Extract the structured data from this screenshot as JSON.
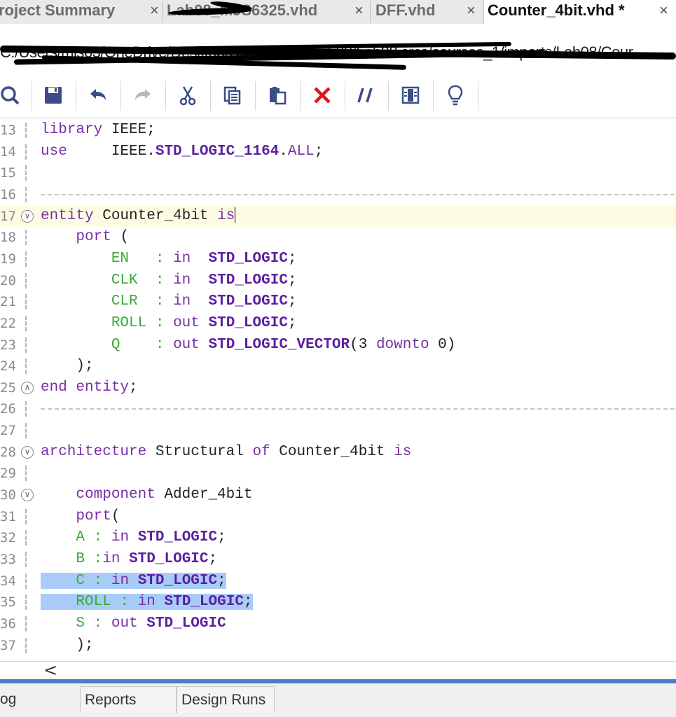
{
  "tabs": [
    {
      "label": "roject Summary",
      "close": "×"
    },
    {
      "label": "Lab08_MJS6325.vhd",
      "close": "×"
    },
    {
      "label": "DFF.vhd",
      "close": "×"
    },
    {
      "label": "Counter_4bit.vhd *",
      "close": "×"
    }
  ],
  "path": "C:/Users/mjs63/OneDrive/Desktop/CMPEN270/Lab08/Lab08.srcs/sources_1/imports/Lab08/Cour",
  "toolbar": [
    {
      "name": "search-icon"
    },
    {
      "name": "save-icon"
    },
    {
      "name": "undo-icon"
    },
    {
      "name": "redo-icon"
    },
    {
      "name": "cut-icon"
    },
    {
      "name": "copy-icon"
    },
    {
      "name": "paste-icon"
    },
    {
      "name": "delete-icon"
    },
    {
      "name": "comment-icon"
    },
    {
      "name": "column-select-icon"
    },
    {
      "name": "lightbulb-icon"
    }
  ],
  "colors": {
    "keyword": "#7a2ea8",
    "type": "#5c1ea0",
    "signal": "#3aaa35",
    "selection": "#a8ccf7",
    "current_line": "#fdfce3"
  },
  "lines": [
    {
      "num": "13",
      "tokens": [
        [
          "kw",
          "library"
        ],
        [
          "plain",
          " IEEE;"
        ]
      ]
    },
    {
      "num": "14",
      "tokens": [
        [
          "kw",
          "use"
        ],
        [
          "plain",
          "     IEEE."
        ],
        [
          "typ",
          "STD_LOGIC_1164"
        ],
        [
          "plain",
          "."
        ],
        [
          "kw",
          "ALL"
        ],
        [
          "plain",
          ";"
        ]
      ]
    },
    {
      "num": "15",
      "tokens": []
    },
    {
      "num": "16",
      "dashed": true,
      "tokens": []
    },
    {
      "num": "17",
      "fold": "open",
      "current": true,
      "caret": true,
      "tokens": [
        [
          "kw",
          "entity"
        ],
        [
          "plain",
          " Counter_4bit "
        ],
        [
          "kw",
          "is"
        ]
      ]
    },
    {
      "num": "18",
      "tokens": [
        [
          "plain",
          "    "
        ],
        [
          "kw",
          "port"
        ],
        [
          "plain",
          " ("
        ]
      ]
    },
    {
      "num": "19",
      "tokens": [
        [
          "plain",
          "        "
        ],
        [
          "sig",
          "EN"
        ],
        [
          "plain",
          "   "
        ],
        [
          "sig",
          ":"
        ],
        [
          "plain",
          " "
        ],
        [
          "kw",
          "in"
        ],
        [
          "plain",
          "  "
        ],
        [
          "typ",
          "STD_LOGIC"
        ],
        [
          "plain",
          ";"
        ]
      ]
    },
    {
      "num": "20",
      "tokens": [
        [
          "plain",
          "        "
        ],
        [
          "sig",
          "CLK"
        ],
        [
          "plain",
          "  "
        ],
        [
          "sig",
          ":"
        ],
        [
          "plain",
          " "
        ],
        [
          "kw",
          "in"
        ],
        [
          "plain",
          "  "
        ],
        [
          "typ",
          "STD_LOGIC"
        ],
        [
          "plain",
          ";"
        ]
      ]
    },
    {
      "num": "21",
      "tokens": [
        [
          "plain",
          "        "
        ],
        [
          "sig",
          "CLR"
        ],
        [
          "plain",
          "  "
        ],
        [
          "sig",
          ":"
        ],
        [
          "plain",
          " "
        ],
        [
          "kw",
          "in"
        ],
        [
          "plain",
          "  "
        ],
        [
          "typ",
          "STD_LOGIC"
        ],
        [
          "plain",
          ";"
        ]
      ]
    },
    {
      "num": "22",
      "tokens": [
        [
          "plain",
          "        "
        ],
        [
          "sig",
          "ROLL"
        ],
        [
          "plain",
          " "
        ],
        [
          "sig",
          ":"
        ],
        [
          "plain",
          " "
        ],
        [
          "kw",
          "out"
        ],
        [
          "plain",
          " "
        ],
        [
          "typ",
          "STD_LOGIC"
        ],
        [
          "plain",
          ";"
        ]
      ]
    },
    {
      "num": "23",
      "tokens": [
        [
          "plain",
          "        "
        ],
        [
          "sig",
          "Q"
        ],
        [
          "plain",
          "    "
        ],
        [
          "sig",
          ":"
        ],
        [
          "plain",
          " "
        ],
        [
          "kw",
          "out"
        ],
        [
          "plain",
          " "
        ],
        [
          "typ",
          "STD_LOGIC_VECTOR"
        ],
        [
          "plain",
          "(3 "
        ],
        [
          "kw",
          "downto"
        ],
        [
          "plain",
          " 0)"
        ]
      ]
    },
    {
      "num": "24",
      "tokens": [
        [
          "plain",
          "    );"
        ]
      ]
    },
    {
      "num": "25",
      "fold": "close",
      "tokens": [
        [
          "kw",
          "end"
        ],
        [
          "plain",
          " "
        ],
        [
          "kw",
          "entity"
        ],
        [
          "plain",
          ";"
        ]
      ]
    },
    {
      "num": "26",
      "dashed": true,
      "tokens": []
    },
    {
      "num": "27",
      "tokens": []
    },
    {
      "num": "28",
      "fold": "open",
      "tokens": [
        [
          "kw",
          "architecture"
        ],
        [
          "plain",
          " Structural "
        ],
        [
          "kw",
          "of"
        ],
        [
          "plain",
          " Counter_4bit "
        ],
        [
          "kw",
          "is"
        ]
      ]
    },
    {
      "num": "29",
      "tokens": []
    },
    {
      "num": "30",
      "fold": "open",
      "tokens": [
        [
          "plain",
          "    "
        ],
        [
          "kw",
          "component"
        ],
        [
          "plain",
          " Adder_4bit"
        ]
      ]
    },
    {
      "num": "31",
      "tokens": [
        [
          "plain",
          "    "
        ],
        [
          "kw",
          "port"
        ],
        [
          "plain",
          "("
        ]
      ]
    },
    {
      "num": "32",
      "tokens": [
        [
          "plain",
          "    "
        ],
        [
          "sig",
          "A"
        ],
        [
          "plain",
          " "
        ],
        [
          "sig",
          ":"
        ],
        [
          "plain",
          " "
        ],
        [
          "kw",
          "in"
        ],
        [
          "plain",
          " "
        ],
        [
          "typ",
          "STD_LOGIC"
        ],
        [
          "plain",
          ";"
        ]
      ]
    },
    {
      "num": "33",
      "tokens": [
        [
          "plain",
          "    "
        ],
        [
          "sig",
          "B"
        ],
        [
          "plain",
          " "
        ],
        [
          "sig",
          ":"
        ],
        [
          "kw",
          "in"
        ],
        [
          "plain",
          " "
        ],
        [
          "typ",
          "STD_LOGIC"
        ],
        [
          "plain",
          ";"
        ]
      ]
    },
    {
      "num": "34",
      "selected": true,
      "tokens": [
        [
          "plain",
          "    "
        ],
        [
          "sig",
          "C"
        ],
        [
          "plain",
          " "
        ],
        [
          "sig",
          ":"
        ],
        [
          "plain",
          " "
        ],
        [
          "kw",
          "in"
        ],
        [
          "plain",
          " "
        ],
        [
          "typ",
          "STD_LOGIC"
        ],
        [
          "plain",
          ";"
        ]
      ]
    },
    {
      "num": "35",
      "selected": true,
      "tokens": [
        [
          "plain",
          "    "
        ],
        [
          "sig",
          "ROLL"
        ],
        [
          "plain",
          " "
        ],
        [
          "sig",
          ":"
        ],
        [
          "plain",
          " "
        ],
        [
          "kw",
          "in"
        ],
        [
          "plain",
          " "
        ],
        [
          "typ",
          "STD_LOGIC"
        ],
        [
          "plain",
          ";"
        ]
      ]
    },
    {
      "num": "36",
      "tokens": [
        [
          "plain",
          "    "
        ],
        [
          "sig",
          "S"
        ],
        [
          "plain",
          " "
        ],
        [
          "sig",
          ":"
        ],
        [
          "plain",
          " "
        ],
        [
          "kw",
          "out"
        ],
        [
          "plain",
          " "
        ],
        [
          "typ",
          "STD_LOGIC"
        ]
      ]
    },
    {
      "num": "37",
      "tokens": [
        [
          "plain",
          "    );"
        ]
      ]
    }
  ],
  "scroll_left": "<",
  "bottom_tabs": [
    {
      "label": "og"
    },
    {
      "label": "Reports"
    },
    {
      "label": "Design Runs"
    }
  ]
}
